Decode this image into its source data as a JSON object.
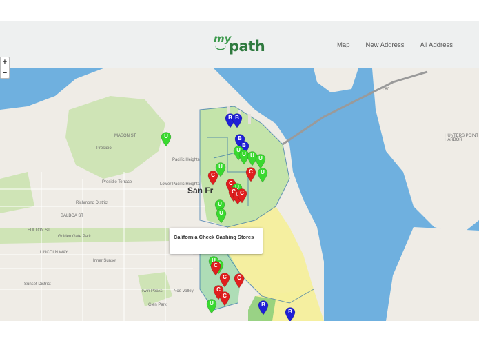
{
  "brand": {
    "logo_my": "my",
    "logo_path": "path"
  },
  "nav": {
    "links": [
      "Map",
      "New Address",
      "All Address"
    ]
  },
  "map": {
    "zoom_in": "+",
    "zoom_out": "−",
    "city_label": "San Fr",
    "popup_text": "California Check Cashing Stores",
    "labels": [
      "Presidio",
      "Presidio Terrace",
      "Richmond District",
      "Lower Pacific Heights",
      "Pacific Heights",
      "Inner Sunset",
      "Sunset District",
      "Golden Gate Park",
      "Noe Valley",
      "Glen Park",
      "Twin Peaks",
      "I 80",
      "HUNTERS POINT HARBOR",
      "BALBOA ST",
      "FULTON ST",
      "LINCOLN WAY",
      "MASON ST"
    ],
    "pin_colors": {
      "B": "#1f1fd6",
      "C": "#e01e1e",
      "U": "#39d92f"
    },
    "pins": [
      {
        "t": "B"
      },
      {
        "t": "B"
      },
      {
        "t": "B"
      },
      {
        "t": "B"
      },
      {
        "t": "U"
      },
      {
        "t": "U"
      },
      {
        "t": "U"
      },
      {
        "t": "U"
      },
      {
        "t": "U"
      },
      {
        "t": "U"
      },
      {
        "t": "C"
      },
      {
        "t": "U"
      },
      {
        "t": "C"
      },
      {
        "t": "C"
      },
      {
        "t": "U"
      },
      {
        "t": "C"
      },
      {
        "t": "C"
      },
      {
        "t": "C"
      },
      {
        "t": "U"
      },
      {
        "t": "U"
      },
      {
        "t": "U"
      },
      {
        "t": "U"
      },
      {
        "t": "C"
      },
      {
        "t": "C"
      },
      {
        "t": "C"
      },
      {
        "t": "C"
      },
      {
        "t": "C"
      },
      {
        "t": "U"
      },
      {
        "t": "B"
      },
      {
        "t": "B"
      }
    ]
  }
}
